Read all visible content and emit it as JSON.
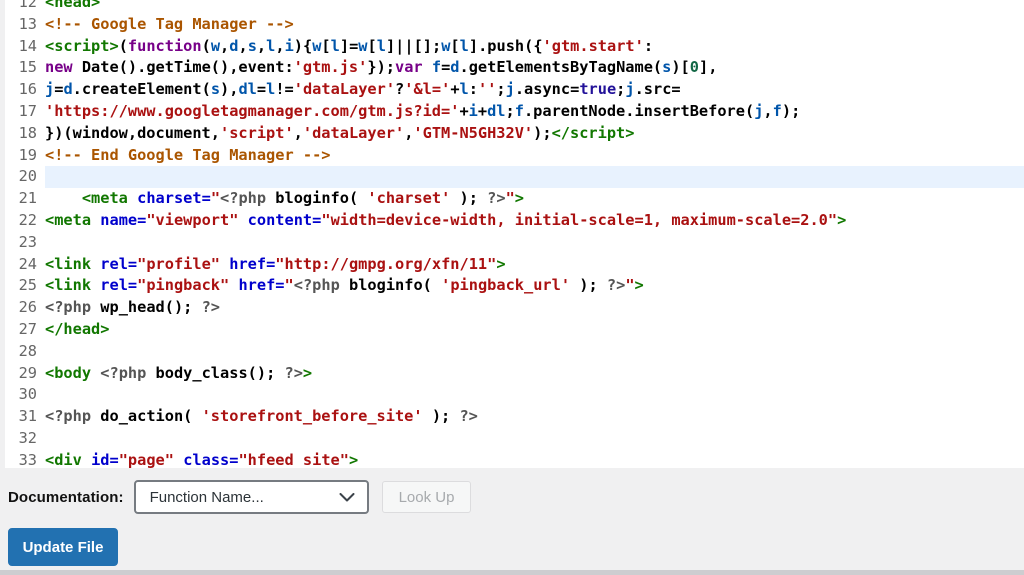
{
  "editor": {
    "active_line": 20,
    "syntax_colors": {
      "p": "#000000",
      "t": "#117700",
      "a": "#0000cc",
      "s": "#aa1111",
      "c": "#aa5500",
      "k": "#770088",
      "v": "#0055aa",
      "m": "#555555",
      "b": "#221199",
      "n": "#116644"
    },
    "active_line_color": "#e8f2fe",
    "lines": [
      {
        "no": 12,
        "spans": [
          [
            "t",
            "<head>"
          ]
        ]
      },
      {
        "no": 13,
        "spans": [
          [
            "c",
            "<!-- Google Tag Manager -->"
          ]
        ]
      },
      {
        "no": 14,
        "spans": [
          [
            "t",
            "<script>"
          ],
          [
            "p",
            "("
          ],
          [
            "k",
            "function"
          ],
          [
            "p",
            "("
          ],
          [
            "v",
            "w"
          ],
          [
            "p",
            ","
          ],
          [
            "v",
            "d"
          ],
          [
            "p",
            ","
          ],
          [
            "v",
            "s"
          ],
          [
            "p",
            ","
          ],
          [
            "v",
            "l"
          ],
          [
            "p",
            ","
          ],
          [
            "v",
            "i"
          ],
          [
            "p",
            "){"
          ],
          [
            "v",
            "w"
          ],
          [
            "p",
            "["
          ],
          [
            "v",
            "l"
          ],
          [
            "p",
            "]="
          ],
          [
            "v",
            "w"
          ],
          [
            "p",
            "["
          ],
          [
            "v",
            "l"
          ],
          [
            "p",
            "]||[];"
          ],
          [
            "v",
            "w"
          ],
          [
            "p",
            "["
          ],
          [
            "v",
            "l"
          ],
          [
            "p",
            "].push({"
          ],
          [
            "s",
            "'gtm.start'"
          ],
          [
            "p",
            ":"
          ]
        ]
      },
      {
        "no": 15,
        "spans": [
          [
            "k",
            "new"
          ],
          [
            "p",
            " Date().getTime(),event:"
          ],
          [
            "s",
            "'gtm.js'"
          ],
          [
            "p",
            "});"
          ],
          [
            "k",
            "var"
          ],
          [
            "p",
            " "
          ],
          [
            "v",
            "f"
          ],
          [
            "p",
            "="
          ],
          [
            "v",
            "d"
          ],
          [
            "p",
            ".getElementsByTagName("
          ],
          [
            "v",
            "s"
          ],
          [
            "p",
            ")["
          ],
          [
            "n",
            "0"
          ],
          [
            "p",
            "],"
          ]
        ]
      },
      {
        "no": 16,
        "spans": [
          [
            "v",
            "j"
          ],
          [
            "p",
            "="
          ],
          [
            "v",
            "d"
          ],
          [
            "p",
            ".createElement("
          ],
          [
            "v",
            "s"
          ],
          [
            "p",
            "),"
          ],
          [
            "v",
            "dl"
          ],
          [
            "p",
            "="
          ],
          [
            "v",
            "l"
          ],
          [
            "p",
            "!="
          ],
          [
            "s",
            "'dataLayer'"
          ],
          [
            "p",
            "?"
          ],
          [
            "s",
            "'&l='"
          ],
          [
            "p",
            "+"
          ],
          [
            "v",
            "l"
          ],
          [
            "p",
            ":"
          ],
          [
            "s",
            "''"
          ],
          [
            "p",
            ";"
          ],
          [
            "v",
            "j"
          ],
          [
            "p",
            ".async="
          ],
          [
            "b",
            "true"
          ],
          [
            "p",
            ";"
          ],
          [
            "v",
            "j"
          ],
          [
            "p",
            ".src="
          ]
        ]
      },
      {
        "no": 17,
        "spans": [
          [
            "s",
            "'https://www.googletagmanager.com/gtm.js?id='"
          ],
          [
            "p",
            "+"
          ],
          [
            "v",
            "i"
          ],
          [
            "p",
            "+"
          ],
          [
            "v",
            "dl"
          ],
          [
            "p",
            ";"
          ],
          [
            "v",
            "f"
          ],
          [
            "p",
            ".parentNode.insertBefore("
          ],
          [
            "v",
            "j"
          ],
          [
            "p",
            ","
          ],
          [
            "v",
            "f"
          ],
          [
            "p",
            ");"
          ]
        ]
      },
      {
        "no": 18,
        "spans": [
          [
            "p",
            "})(window,document,"
          ],
          [
            "s",
            "'script'"
          ],
          [
            "p",
            ","
          ],
          [
            "s",
            "'dataLayer'"
          ],
          [
            "p",
            ","
          ],
          [
            "s",
            "'GTM-N5GH32V'"
          ],
          [
            "p",
            ");"
          ],
          [
            "t",
            "</script>"
          ]
        ]
      },
      {
        "no": 19,
        "spans": [
          [
            "c",
            "<!-- End Google Tag Manager -->"
          ]
        ]
      },
      {
        "no": 20,
        "spans": []
      },
      {
        "no": 21,
        "spans": [
          [
            "p",
            "    "
          ],
          [
            "t",
            "<meta"
          ],
          [
            "p",
            " "
          ],
          [
            "a",
            "charset="
          ],
          [
            "s",
            "\""
          ],
          [
            "m",
            "<?php"
          ],
          [
            "p",
            " bloginfo( "
          ],
          [
            "s",
            "'charset'"
          ],
          [
            "p",
            " ); "
          ],
          [
            "m",
            "?>"
          ],
          [
            "s",
            "\""
          ],
          [
            "t",
            ">"
          ]
        ]
      },
      {
        "no": 22,
        "spans": [
          [
            "t",
            "<meta"
          ],
          [
            "p",
            " "
          ],
          [
            "a",
            "name="
          ],
          [
            "s",
            "\"viewport\""
          ],
          [
            "p",
            " "
          ],
          [
            "a",
            "content="
          ],
          [
            "s",
            "\"width=device-width, initial-scale=1, maximum-scale=2.0\""
          ],
          [
            "t",
            ">"
          ]
        ]
      },
      {
        "no": 23,
        "spans": []
      },
      {
        "no": 24,
        "spans": [
          [
            "t",
            "<link"
          ],
          [
            "p",
            " "
          ],
          [
            "a",
            "rel="
          ],
          [
            "s",
            "\"profile\""
          ],
          [
            "p",
            " "
          ],
          [
            "a",
            "href="
          ],
          [
            "s",
            "\"http://gmpg.org/xfn/11\""
          ],
          [
            "t",
            ">"
          ]
        ]
      },
      {
        "no": 25,
        "spans": [
          [
            "t",
            "<link"
          ],
          [
            "p",
            " "
          ],
          [
            "a",
            "rel="
          ],
          [
            "s",
            "\"pingback\""
          ],
          [
            "p",
            " "
          ],
          [
            "a",
            "href="
          ],
          [
            "s",
            "\""
          ],
          [
            "m",
            "<?php"
          ],
          [
            "p",
            " bloginfo( "
          ],
          [
            "s",
            "'pingback_url'"
          ],
          [
            "p",
            " ); "
          ],
          [
            "m",
            "?>"
          ],
          [
            "s",
            "\""
          ],
          [
            "t",
            ">"
          ]
        ]
      },
      {
        "no": 26,
        "spans": [
          [
            "m",
            "<?php"
          ],
          [
            "p",
            " wp_head(); "
          ],
          [
            "m",
            "?>"
          ]
        ]
      },
      {
        "no": 27,
        "spans": [
          [
            "t",
            "</head>"
          ]
        ]
      },
      {
        "no": 28,
        "spans": []
      },
      {
        "no": 29,
        "spans": [
          [
            "t",
            "<body"
          ],
          [
            "p",
            " "
          ],
          [
            "m",
            "<?php"
          ],
          [
            "p",
            " body_class(); "
          ],
          [
            "m",
            "?>"
          ],
          [
            "t",
            ">"
          ]
        ]
      },
      {
        "no": 30,
        "spans": []
      },
      {
        "no": 31,
        "spans": [
          [
            "m",
            "<?php"
          ],
          [
            "p",
            " do_action( "
          ],
          [
            "s",
            "'storefront_before_site'"
          ],
          [
            "p",
            " ); "
          ],
          [
            "m",
            "?>"
          ]
        ]
      },
      {
        "no": 32,
        "spans": []
      },
      {
        "no": 33,
        "spans": [
          [
            "t",
            "<div"
          ],
          [
            "p",
            " "
          ],
          [
            "a",
            "id="
          ],
          [
            "s",
            "\"page\""
          ],
          [
            "p",
            " "
          ],
          [
            "a",
            "class="
          ],
          [
            "s",
            "\"hfeed site\""
          ],
          [
            "t",
            ">"
          ]
        ]
      }
    ]
  },
  "footer": {
    "documentation_label": "Documentation:",
    "select_value": "Function Name...",
    "lookup_label": "Look Up",
    "update_label": "Update File",
    "update_button_color": "#2271b1",
    "lookup_disabled_text_color": "#a7aaad"
  }
}
